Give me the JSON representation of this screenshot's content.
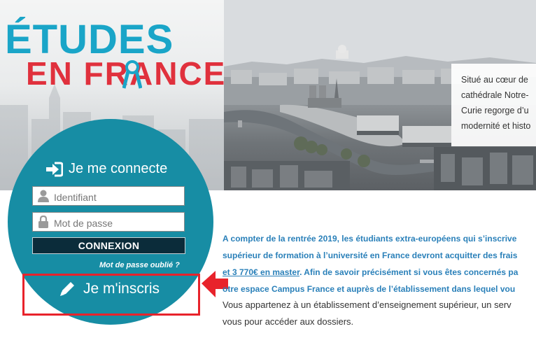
{
  "logo": {
    "line1": "ÉTUDES",
    "line2": "EN FRANCE"
  },
  "photo": {
    "caption_lines": [
      "Situé au cœur de",
      "cathédrale Notre-",
      "Curie regorge d’u",
      "modernité et histo"
    ]
  },
  "login": {
    "title": "Je me connecte",
    "identifier_placeholder": "Identifiant",
    "password_placeholder": "Mot de passe",
    "submit_label": "CONNEXION",
    "forgot_label": "Mot de passe oublié ?",
    "register_label": "Je m'inscris"
  },
  "content": {
    "announcement_lines": [
      "A compter de la rentrée 2019, les étudiants extra-européens qui s’inscrive",
      "supérieur de formation à l’université en France devront acquitter des frais",
      "et 3 770€ en master",
      ". Afin de savoir précisément si vous êtes concernés pa",
      "otre espace Campus France et auprès de l’établissement dans lequel vou"
    ],
    "info_lines": [
      "Vous appartenez à un établissement d’enseignement supérieur, un serv",
      "vous pour accéder aux dossiers."
    ]
  },
  "colors": {
    "brand_blue": "#1aa5c8",
    "brand_red": "#e0313d",
    "circle": "#178da4",
    "button_dark": "#0b2c3a",
    "link_blue": "#2a80b9",
    "highlight_red": "#e8232b"
  },
  "icons": {
    "login": "sign-in-icon",
    "user": "user-icon",
    "lock": "lock-icon",
    "pencil": "pencil-icon",
    "annotation": "red-arrow"
  }
}
